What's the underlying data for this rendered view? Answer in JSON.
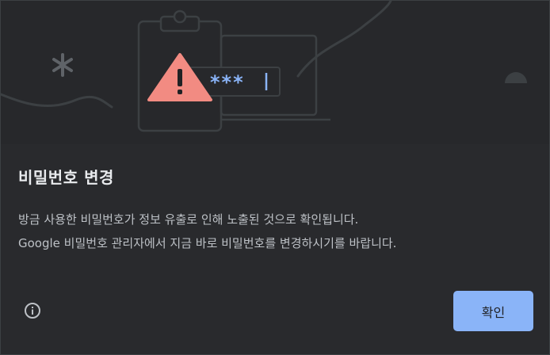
{
  "dialog": {
    "illustration": {
      "icons": [
        "clipboard-icon",
        "warning-triangle-icon",
        "asterisk-icon",
        "laptop-icon",
        "password-field-icon"
      ],
      "password_mask": "***",
      "colors": {
        "warning": "#f28b82",
        "mask": "#8ab4f8",
        "line": "#3c4043"
      }
    },
    "title": "비밀번호 변경",
    "description_line1": "방금 사용한 비밀번호가 정보 유출로 인해 노출된 것으로 확인됩니다.",
    "description_line2": "Google 비밀번호 관리자에서 지금 바로 비밀번호를 변경하시기를 바랍니다.",
    "info_icon": "info-icon",
    "confirm_label": "확인",
    "colors": {
      "background": "#292a2d",
      "accent": "#8ab4f8",
      "title": "#e8eaed",
      "text": "#bdc1c6"
    }
  }
}
